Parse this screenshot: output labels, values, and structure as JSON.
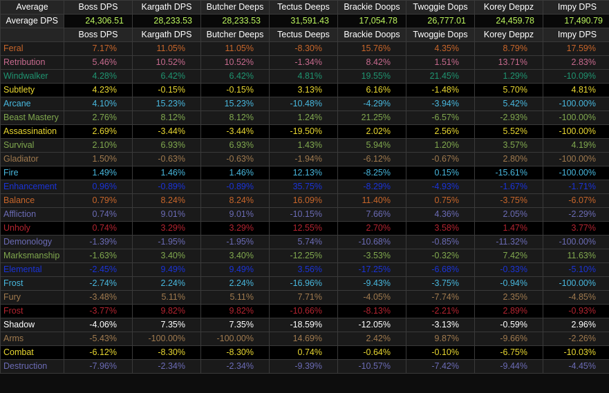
{
  "table": {
    "header": {
      "label": "Average",
      "columns": [
        "Boss DPS",
        "Kargath DPS",
        "Butcher Deeps",
        "Tectus Deeps",
        "Brackie Doops",
        "Twoggie Dops",
        "Korey Deppz",
        "Impy DPS"
      ]
    },
    "average_row": {
      "label": "Average DPS",
      "values": [
        "24,306.51",
        "28,233.53",
        "28,233.53",
        "31,591.43",
        "17,054.78",
        "26,777.01",
        "24,459.78",
        "17,490.79"
      ],
      "color": "#b9f25c"
    },
    "subheader": {
      "label": "",
      "columns": [
        "Boss DPS",
        "Kargath DPS",
        "Butcher Deeps",
        "Tectus Deeps",
        "Brackie Doops",
        "Twoggie Dops",
        "Korey Deppz",
        "Impy DPS"
      ]
    },
    "rows": [
      {
        "label": "Feral",
        "color": "#c8662a",
        "shade": "alt",
        "values": [
          "7.17%",
          "11.05%",
          "11.05%",
          "-8.30%",
          "15.76%",
          "4.35%",
          "8.79%",
          "17.59%"
        ]
      },
      {
        "label": "Retribution",
        "color": "#c76a8e",
        "shade": "alt",
        "values": [
          "5.46%",
          "10.52%",
          "10.52%",
          "-1.34%",
          "8.42%",
          "1.51%",
          "13.71%",
          "2.83%"
        ]
      },
      {
        "label": "Windwalker",
        "color": "#1f9470",
        "shade": "alt",
        "values": [
          "4.28%",
          "6.42%",
          "6.42%",
          "4.81%",
          "19.55%",
          "21.45%",
          "1.29%",
          "-10.09%"
        ]
      },
      {
        "label": "Subtlety",
        "color": "#e8d731",
        "shade": "dark",
        "values": [
          "4.23%",
          "-0.15%",
          "-0.15%",
          "3.13%",
          "6.16%",
          "-1.48%",
          "5.70%",
          "4.81%"
        ]
      },
      {
        "label": "Arcane",
        "color": "#48b7dd",
        "shade": "alt",
        "values": [
          "4.10%",
          "15.23%",
          "15.23%",
          "-10.48%",
          "-4.29%",
          "-3.94%",
          "5.42%",
          "-100.00%"
        ]
      },
      {
        "label": "Beast Mastery",
        "color": "#80a84e",
        "shade": "alt",
        "values": [
          "2.76%",
          "8.12%",
          "8.12%",
          "1.24%",
          "21.25%",
          "-6.57%",
          "-2.93%",
          "-100.00%"
        ]
      },
      {
        "label": "Assassination",
        "color": "#e8d731",
        "shade": "dark",
        "values": [
          "2.69%",
          "-3.44%",
          "-3.44%",
          "-19.50%",
          "2.02%",
          "2.56%",
          "5.52%",
          "-100.00%"
        ]
      },
      {
        "label": "Survival",
        "color": "#80a84e",
        "shade": "alt",
        "values": [
          "2.10%",
          "6.93%",
          "6.93%",
          "1.43%",
          "5.94%",
          "1.20%",
          "3.57%",
          "4.19%"
        ]
      },
      {
        "label": "Gladiator",
        "color": "#a07a4e",
        "shade": "alt",
        "values": [
          "1.50%",
          "-0.63%",
          "-0.63%",
          "-1.94%",
          "-6.12%",
          "-0.67%",
          "2.80%",
          "-100.00%"
        ]
      },
      {
        "label": "Fire",
        "color": "#48b7dd",
        "shade": "dark",
        "values": [
          "1.49%",
          "1.46%",
          "1.46%",
          "12.13%",
          "-8.25%",
          "0.15%",
          "-15.61%",
          "-100.00%"
        ]
      },
      {
        "label": "Enhancement",
        "color": "#1a33d8",
        "shade": "alt",
        "values": [
          "0.96%",
          "-0.89%",
          "-0.89%",
          "35.75%",
          "-8.29%",
          "-4.93%",
          "-1.67%",
          "-1.71%"
        ]
      },
      {
        "label": "Balance",
        "color": "#c8662a",
        "shade": "alt",
        "values": [
          "0.79%",
          "8.24%",
          "8.24%",
          "16.09%",
          "11.40%",
          "0.75%",
          "-3.75%",
          "-6.07%"
        ]
      },
      {
        "label": "Affliction",
        "color": "#6b6bb5",
        "shade": "alt",
        "values": [
          "0.74%",
          "9.01%",
          "9.01%",
          "-10.15%",
          "7.66%",
          "4.36%",
          "2.05%",
          "-2.29%"
        ]
      },
      {
        "label": "Unholy",
        "color": "#b32430",
        "shade": "dark",
        "values": [
          "0.74%",
          "3.29%",
          "3.29%",
          "12.55%",
          "2.70%",
          "3.58%",
          "1.47%",
          "3.77%"
        ]
      },
      {
        "label": "Demonology",
        "color": "#6b6bb5",
        "shade": "alt",
        "values": [
          "-1.39%",
          "-1.95%",
          "-1.95%",
          "5.74%",
          "-10.68%",
          "-0.85%",
          "-11.32%",
          "-100.00%"
        ]
      },
      {
        "label": "Marksmanship",
        "color": "#80a84e",
        "shade": "alt",
        "values": [
          "-1.63%",
          "3.40%",
          "3.40%",
          "-12.25%",
          "-3.53%",
          "-0.32%",
          "7.42%",
          "11.63%"
        ]
      },
      {
        "label": "Elemental",
        "color": "#1a33d8",
        "shade": "alt",
        "values": [
          "-2.45%",
          "9.49%",
          "9.49%",
          "3.56%",
          "-17.25%",
          "-6.68%",
          "-0.33%",
          "-5.10%"
        ]
      },
      {
        "label": "Frost",
        "color": "#48b7dd",
        "shade": "alt",
        "values": [
          "-2.74%",
          "2.24%",
          "2.24%",
          "-16.96%",
          "-9.43%",
          "-3.75%",
          "-0.94%",
          "-100.00%"
        ]
      },
      {
        "label": "Fury",
        "color": "#a07a4e",
        "shade": "alt",
        "values": [
          "-3.48%",
          "5.11%",
          "5.11%",
          "7.71%",
          "-4.05%",
          "-7.74%",
          "2.35%",
          "-4.85%"
        ]
      },
      {
        "label": "Frost",
        "color": "#b32430",
        "shade": "dark",
        "values": [
          "-3.77%",
          "9.82%",
          "9.82%",
          "-10.66%",
          "-8.13%",
          "-2.21%",
          "2.89%",
          "-0.93%"
        ]
      },
      {
        "label": "Shadow",
        "color": "#ffffff",
        "shade": "alt",
        "values": [
          "-4.06%",
          "7.35%",
          "7.35%",
          "-18.59%",
          "-12.05%",
          "-3.13%",
          "-0.59%",
          "2.96%"
        ]
      },
      {
        "label": "Arms",
        "color": "#a07a4e",
        "shade": "alt",
        "values": [
          "-5.43%",
          "-100.00%",
          "-100.00%",
          "14.69%",
          "2.42%",
          "9.87%",
          "-9.66%",
          "-2.26%"
        ]
      },
      {
        "label": "Combat",
        "color": "#e8d731",
        "shade": "dark",
        "values": [
          "-6.12%",
          "-8.30%",
          "-8.30%",
          "0.74%",
          "-0.64%",
          "-0.10%",
          "-6.75%",
          "-10.03%"
        ]
      },
      {
        "label": "Destruction",
        "color": "#6b6bb5",
        "shade": "alt",
        "values": [
          "-7.96%",
          "-2.34%",
          "-2.34%",
          "-9.39%",
          "-10.57%",
          "-7.42%",
          "-9.44%",
          "-4.45%"
        ]
      }
    ]
  }
}
